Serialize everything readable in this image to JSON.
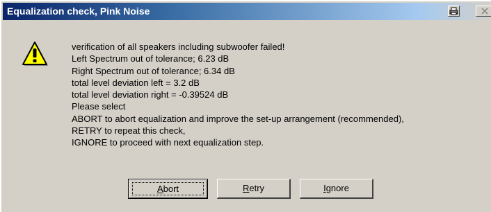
{
  "window": {
    "title": "Equalization check, Pink Noise"
  },
  "icons": {
    "dialog_icon": "warning-icon",
    "print_button": "printer-icon",
    "close_button": "close-icon"
  },
  "message": {
    "lines": [
      "verification of all speakers including subwoofer failed!",
      "Left Spectrum out of tolerance; 6.23 dB",
      "Right Spectrum out of tolerance; 6.34 dB",
      "total level deviation left = 3.2 dB",
      "total level deviation right = -0.39524 dB",
      "Please select",
      "ABORT to abort equalization and improve the set-up arrangement (recommended),",
      "RETRY to repeat this check,",
      "IGNORE to proceed with next equalization step."
    ]
  },
  "buttons": {
    "abort": {
      "first": "A",
      "rest": "bort"
    },
    "retry": {
      "first": "R",
      "rest": "etry"
    },
    "ignore": {
      "first": "I",
      "rest": "gnore"
    }
  },
  "colors": {
    "titlebar_start": "#0a246a",
    "titlebar_end": "#a6caf0",
    "dialog_face": "#d4d0c8",
    "warning_yellow": "#ffff00"
  }
}
